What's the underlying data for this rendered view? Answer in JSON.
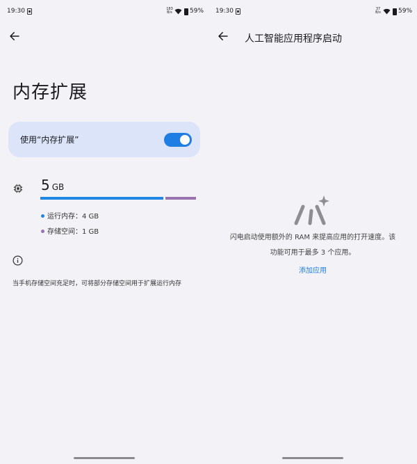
{
  "status_bar": {
    "time": "19:30",
    "left_net_speed": "183\nB/s",
    "right_net_speed": "37\nB/s",
    "battery": "59%"
  },
  "left": {
    "title": "内存扩展",
    "toggle": {
      "label": "使用“内存扩展”",
      "on": true
    },
    "memory": {
      "total_value": "5",
      "total_unit": "GB",
      "ram_fraction": 0.8,
      "ram_label": "运行内存：4 GB",
      "storage_label": "存储空间：1 GB"
    },
    "info_text": "当手机存储空间充足时，可将部分存储空间用于扩展运行内存"
  },
  "right": {
    "title": "人工智能应用程序启动",
    "empty_desc_line1": "闪电启动使用额外的 RAM 来提高应用的打开速度。该",
    "empty_desc_line2": "功能可用于最多 3 个应用。",
    "add_link": "添加应用"
  },
  "colors": {
    "accent": "#1f7ee3",
    "ram_bar": "#1f86e6",
    "storage_bar": "#9a72b0",
    "toggle_card": "#dbe4f9"
  },
  "icons": {
    "back": "arrow-left-icon",
    "chip": "memory-chip-icon",
    "info": "info-icon",
    "empty": "speed-sparkle-icon"
  }
}
